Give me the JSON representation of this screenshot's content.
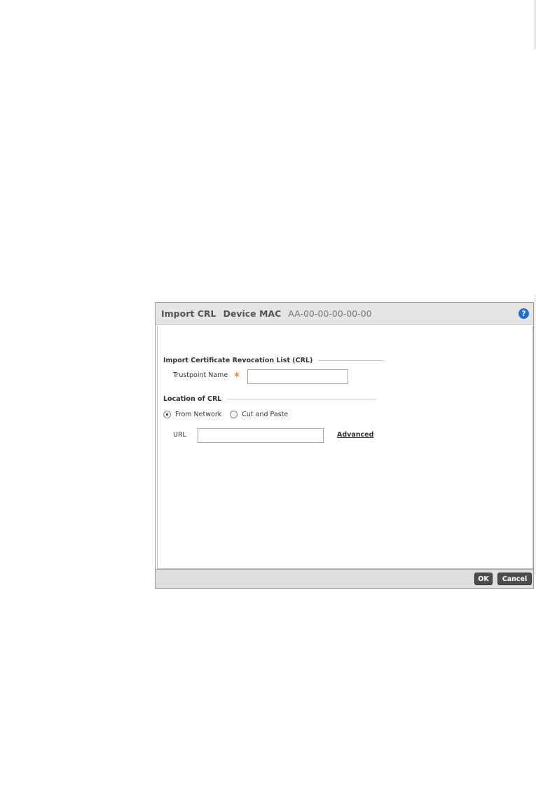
{
  "dialog": {
    "title": "Import CRL",
    "device_label": "Device MAC",
    "device_mac": "AA-00-00-00-00-00",
    "help_icon": "?"
  },
  "section_import": {
    "title": "Import Certificate Revocation List (CRL)",
    "trustpoint_label": "Trustpoint Name",
    "required_marker": "*",
    "trustpoint_value": ""
  },
  "section_location": {
    "title": "Location of CRL",
    "options": [
      {
        "label": "From Network",
        "selected": true
      },
      {
        "label": "Cut and Paste",
        "selected": false
      }
    ],
    "url_label": "URL",
    "url_value": "",
    "advanced_link": "Advanced"
  },
  "footer": {
    "ok_label": "OK",
    "cancel_label": "Cancel"
  },
  "colors": {
    "required": "#f08a1c",
    "help": "#1a6ed8",
    "button": "#4d4d4d"
  }
}
